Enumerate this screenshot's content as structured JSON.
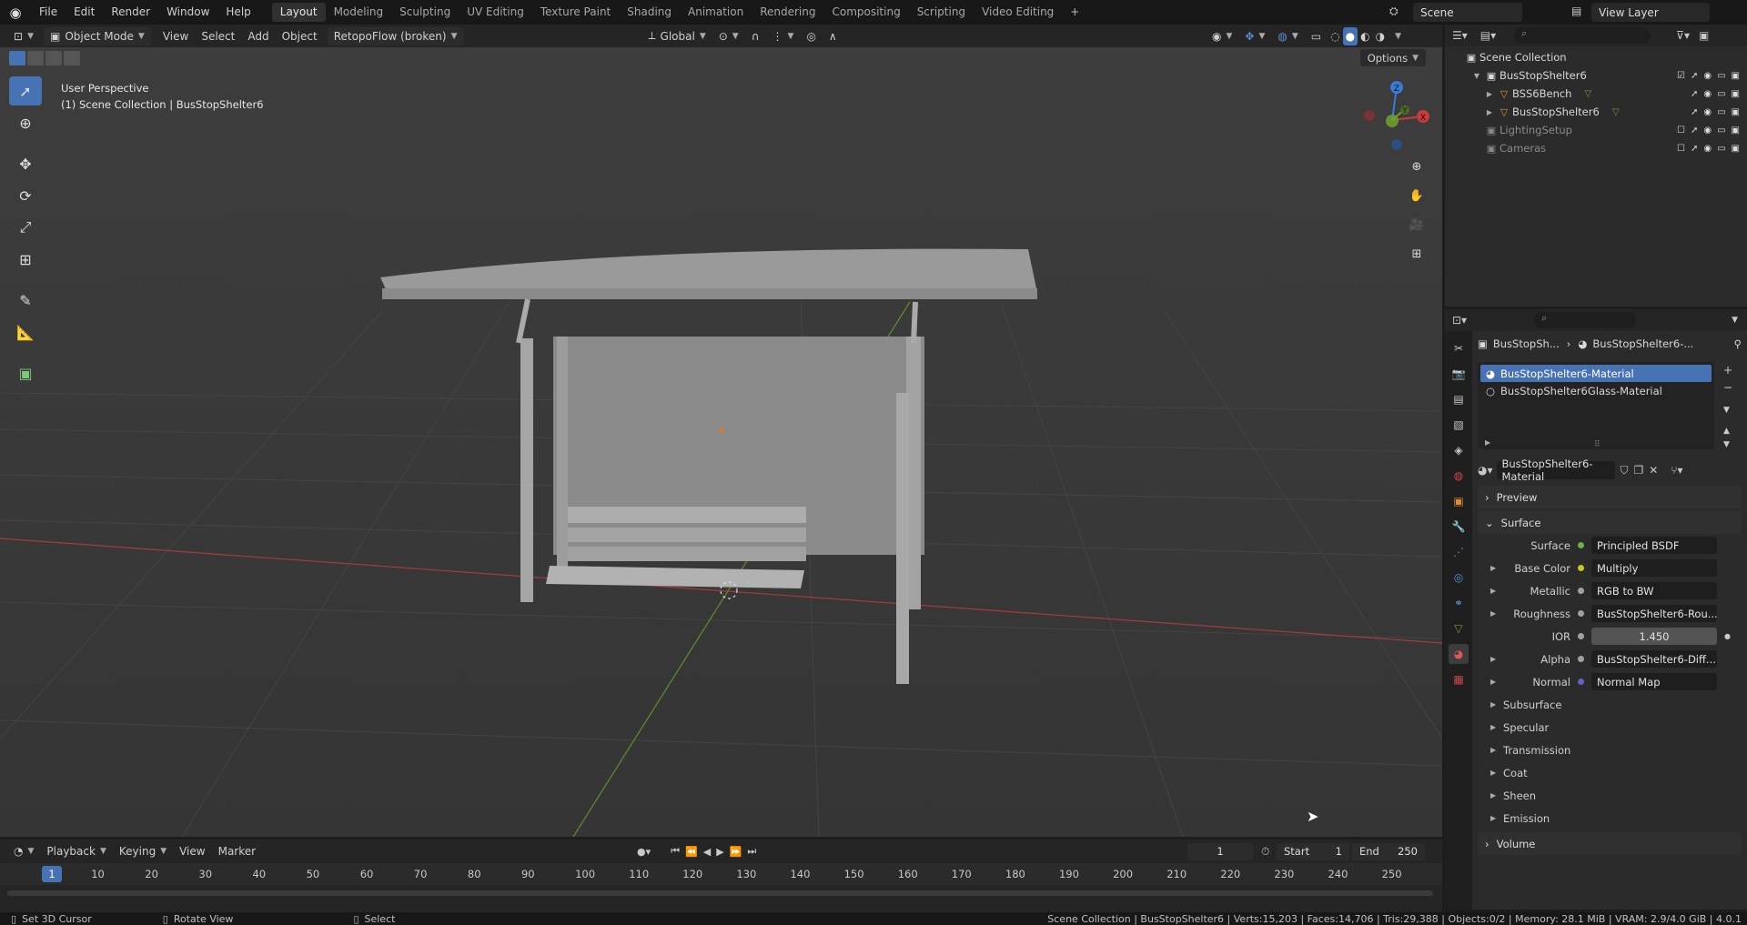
{
  "topbar": {
    "menus": [
      "File",
      "Edit",
      "Render",
      "Window",
      "Help"
    ],
    "workspaces": [
      "Layout",
      "Modeling",
      "Sculpting",
      "UV Editing",
      "Texture Paint",
      "Shading",
      "Animation",
      "Rendering",
      "Compositing",
      "Scripting",
      "Video Editing"
    ],
    "active_workspace": "Layout",
    "add_workspace": "+",
    "scene": "Scene",
    "view_layer": "View Layer"
  },
  "viewport_header": {
    "mode": "Object Mode",
    "menus": [
      "View",
      "Select",
      "Add",
      "Object"
    ],
    "addon": "RetopoFlow (broken)",
    "orientation": "Global",
    "options": "Options"
  },
  "viewport": {
    "perspective": "User Perspective",
    "collection_info": "(1) Scene Collection | BusStopShelter6",
    "gizmo_axes": [
      "Z",
      "Y",
      "X"
    ]
  },
  "outliner": {
    "root": "Scene Collection",
    "rows": [
      {
        "name": "BusStopShelter6",
        "indent": 1,
        "icon": "collection-icon",
        "dim": false,
        "checked": true
      },
      {
        "name": "BSS6Bench",
        "indent": 2,
        "icon": "mesh-object-icon",
        "dim": false,
        "checked": null
      },
      {
        "name": "BusStopShelter6",
        "indent": 2,
        "icon": "mesh-object-icon",
        "dim": false,
        "checked": null
      },
      {
        "name": "LightingSetup",
        "indent": 1,
        "icon": "collection-icon",
        "dim": true,
        "checked": false
      },
      {
        "name": "Cameras",
        "indent": 1,
        "icon": "collection-icon",
        "dim": true,
        "checked": false
      }
    ]
  },
  "properties": {
    "breadcrumb_object": "BusStopSh...",
    "breadcrumb_material": "BusStopShelter6-...",
    "material_slots": [
      "BusStopShelter6-Material",
      "BusStopShelter6Glass-Material"
    ],
    "active_material": "BusStopShelter6-Material",
    "panels": {
      "preview": "Preview",
      "surface": "Surface",
      "volume": "Volume"
    },
    "surface_rows": [
      {
        "label": "Surface",
        "value": "Principled BSDF",
        "dot": "#6ab04c",
        "tri": false,
        "num": false
      },
      {
        "label": "Base Color",
        "value": "Multiply",
        "dot": "#c7c729",
        "tri": true,
        "num": false
      },
      {
        "label": "Metallic",
        "value": "RGB to BW",
        "dot": "#a1a1a1",
        "tri": true,
        "num": false
      },
      {
        "label": "Roughness",
        "value": "BusStopShelter6-Rou...",
        "dot": "#a1a1a1",
        "tri": true,
        "num": false
      },
      {
        "label": "IOR",
        "value": "1.450",
        "dot": "#a1a1a1",
        "tri": false,
        "num": true
      },
      {
        "label": "Alpha",
        "value": "BusStopShelter6-Diff...",
        "dot": "#a1a1a1",
        "tri": true,
        "num": false
      },
      {
        "label": "Normal",
        "value": "Normal Map",
        "dot": "#6363c7",
        "tri": true,
        "num": false
      }
    ],
    "subpanels": [
      "Subsurface",
      "Specular",
      "Transmission",
      "Coat",
      "Sheen",
      "Emission"
    ]
  },
  "timeline": {
    "menus": [
      "Playback",
      "Keying",
      "View",
      "Marker"
    ],
    "current_frame": "1",
    "start_label": "Start",
    "start": "1",
    "end_label": "End",
    "end": "250",
    "ruler": [
      "1",
      "10",
      "20",
      "30",
      "40",
      "50",
      "60",
      "70",
      "80",
      "90",
      "100",
      "110",
      "120",
      "130",
      "140",
      "150",
      "160",
      "170",
      "180",
      "190",
      "200",
      "210",
      "220",
      "230",
      "240",
      "250"
    ]
  },
  "statusbar": {
    "left": [
      "Set 3D Cursor",
      "Rotate View",
      "Select"
    ],
    "right": "Scene Collection | BusStopShelter6 | Verts:15,203 | Faces:14,706 | Tris:29,388 | Objects:0/2 | Memory: 28.1 MiB | VRAM: 2.9/4.0 GiB | 4.0.1"
  },
  "colors": {
    "accent": "#4772b3",
    "x_axis": "#c93b3b",
    "y_axis": "#6ba32d",
    "z_axis": "#3a7bd5"
  }
}
